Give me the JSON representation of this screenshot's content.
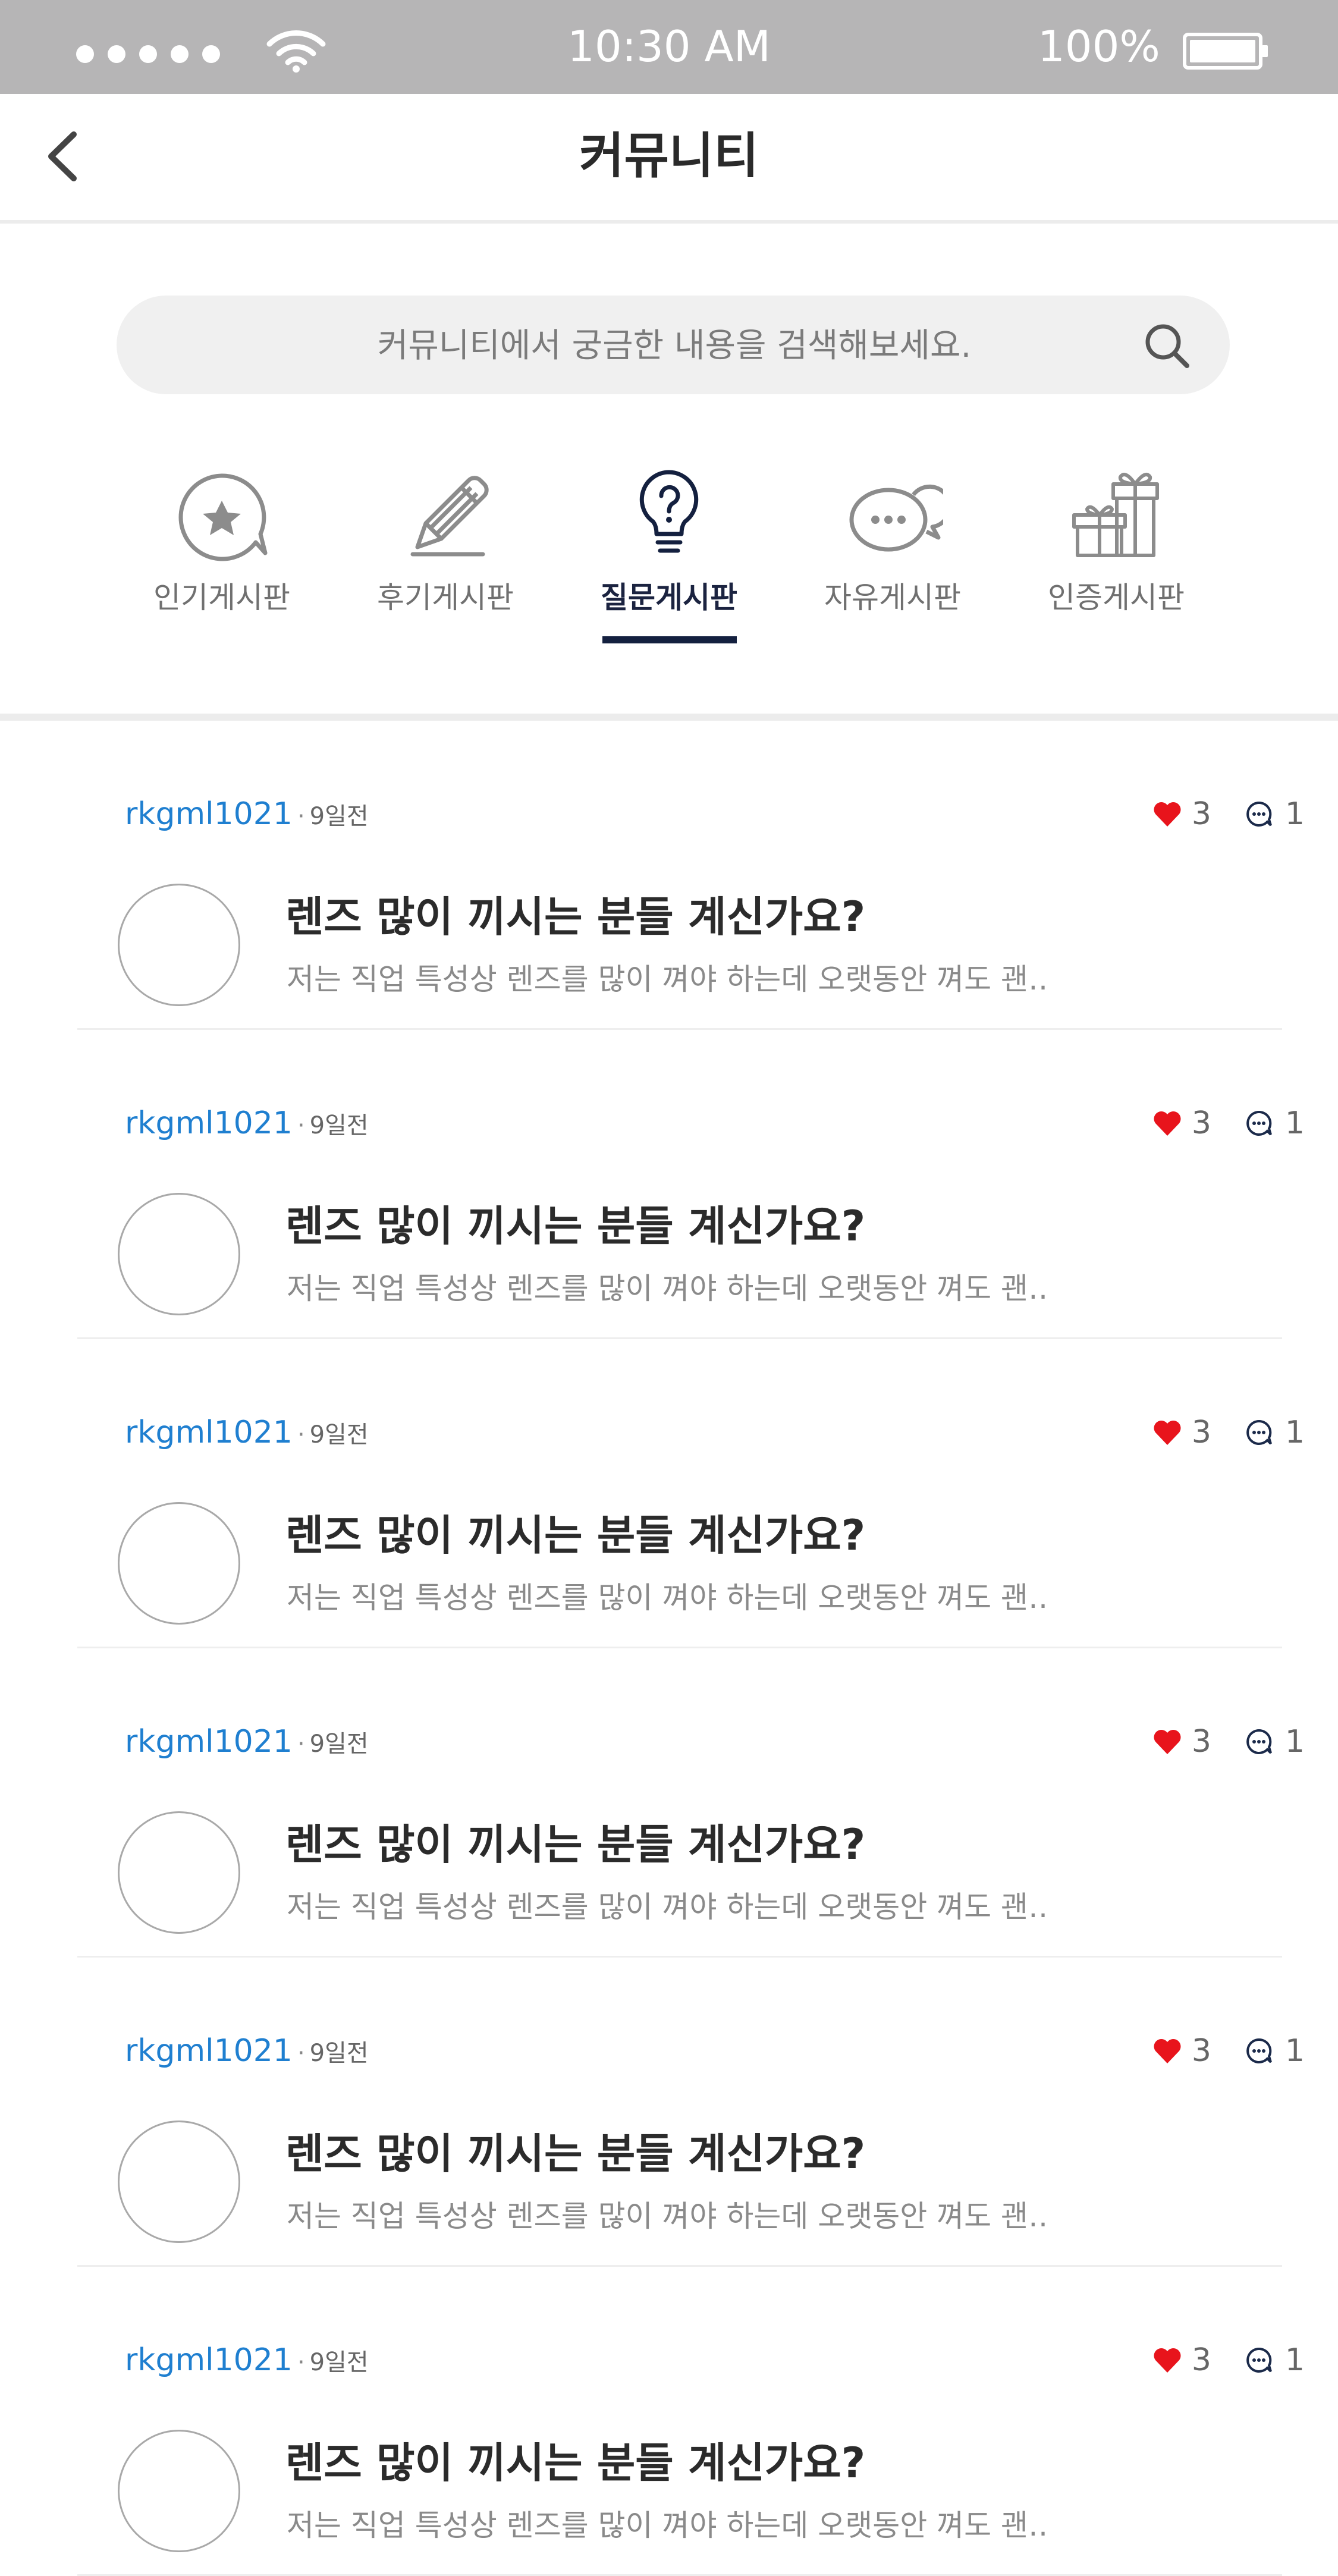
{
  "status_bar": {
    "time": "10:30 AM",
    "battery": "100%",
    "signal_icon": "signal-dots-icon",
    "wifi_icon": "wifi-icon",
    "battery_icon": "battery-icon"
  },
  "header": {
    "title": "커뮤니티",
    "back_icon": "chevron-left-icon"
  },
  "search": {
    "placeholder": "커뮤니티에서 궁금한 내용을 검색해보세요.",
    "icon": "search-icon"
  },
  "tabs": [
    {
      "label": "인기게시판",
      "icon": "star-speech-bubble-icon",
      "active": false
    },
    {
      "label": "후기게시판",
      "icon": "pencil-icon",
      "active": false
    },
    {
      "label": "질문게시판",
      "icon": "lightbulb-question-icon",
      "active": true
    },
    {
      "label": "자유게시판",
      "icon": "chat-bubbles-icon",
      "active": false
    },
    {
      "label": "인증게시판",
      "icon": "gift-icon",
      "active": false
    }
  ],
  "posts": [
    {
      "author": "rkgml1021",
      "separator": "·",
      "time": "9일전",
      "likes": "3",
      "comments": "1",
      "title": "렌즈 많이 끼시는 분들 계신가요?",
      "excerpt": "저는 직업 특성상 렌즈를 많이 껴야 하는데 오랫동안 껴도 괜‥"
    },
    {
      "author": "rkgml1021",
      "separator": "·",
      "time": "9일전",
      "likes": "3",
      "comments": "1",
      "title": "렌즈 많이 끼시는 분들 계신가요?",
      "excerpt": "저는 직업 특성상 렌즈를 많이 껴야 하는데 오랫동안 껴도 괜‥"
    },
    {
      "author": "rkgml1021",
      "separator": "·",
      "time": "9일전",
      "likes": "3",
      "comments": "1",
      "title": "렌즈 많이 끼시는 분들 계신가요?",
      "excerpt": "저는 직업 특성상 렌즈를 많이 껴야 하는데 오랫동안 껴도 괜‥"
    },
    {
      "author": "rkgml1021",
      "separator": "·",
      "time": "9일전",
      "likes": "3",
      "comments": "1",
      "title": "렌즈 많이 끼시는 분들 계신가요?",
      "excerpt": "저는 직업 특성상 렌즈를 많이 껴야 하는데 오랫동안 껴도 괜‥"
    },
    {
      "author": "rkgml1021",
      "separator": "·",
      "time": "9일전",
      "likes": "3",
      "comments": "1",
      "title": "렌즈 많이 끼시는 분들 계신가요?",
      "excerpt": "저는 직업 특성상 렌즈를 많이 껴야 하는데 오랫동안 껴도 괜‥"
    },
    {
      "author": "rkgml1021",
      "separator": "·",
      "time": "9일전",
      "likes": "3",
      "comments": "1",
      "title": "렌즈 많이 끼시는 분들 계신가요?",
      "excerpt": "저는 직업 특성상 렌즈를 많이 껴야 하는데 오랫동안 껴도 괜‥"
    }
  ],
  "colors": {
    "status_bar": "#b6b5b6",
    "author": "#1f7fd0",
    "heart": "#e8141c",
    "active_tab": "#14203f"
  }
}
